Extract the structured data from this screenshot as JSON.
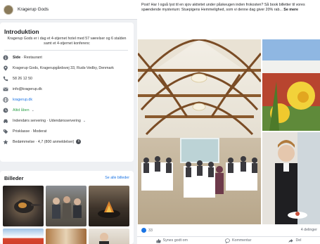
{
  "header": {
    "page_name": "Kragerup Gods",
    "more_label": "..."
  },
  "intro": {
    "title": "Introduktion",
    "description": "Kragerup Gods er i dag et 4-stjernet hotel med 57 værelser og 6 stalden samt et 4-stjernet konferenc",
    "page_type_bold": "Side",
    "page_type_rest": " · Restaurant",
    "address": "Kragerup Gods, Kragerupgårdsvej 33, Ruds-Vedby, Denmark",
    "phone": "58 26 12 50",
    "email": "info@kragerup.dk",
    "website": "kragerup.dk",
    "hours": "Altid åben",
    "hours_chevron": "⌄",
    "services": "Indendørs servering · Udendørsservering",
    "services_chevron": "⌄",
    "price": "Prisklasse · Moderat",
    "rating": "Bedømmelse · 4,7 (800 anmeldelser)",
    "rating_info": "i"
  },
  "photos": {
    "title": "Billeder",
    "see_all": "Se alle billeder"
  },
  "post": {
    "text_lead": "Post! Har I også lyst til en sjov aktivitet under påskeugen inden frokosten? Så book billetter til vores spændende mysterium: Stuepigens Hemmelighed, som vi denne dag giver 20% rab... ",
    "text_more": "Se mere",
    "reaction_count": "33",
    "shares": "4 delinger",
    "action_like": "Synes godt om",
    "action_comment": "Kommentar",
    "action_share": "Del"
  },
  "colors": {
    "facebook_blue": "#1b74e4",
    "open_green": "#31a24c"
  }
}
